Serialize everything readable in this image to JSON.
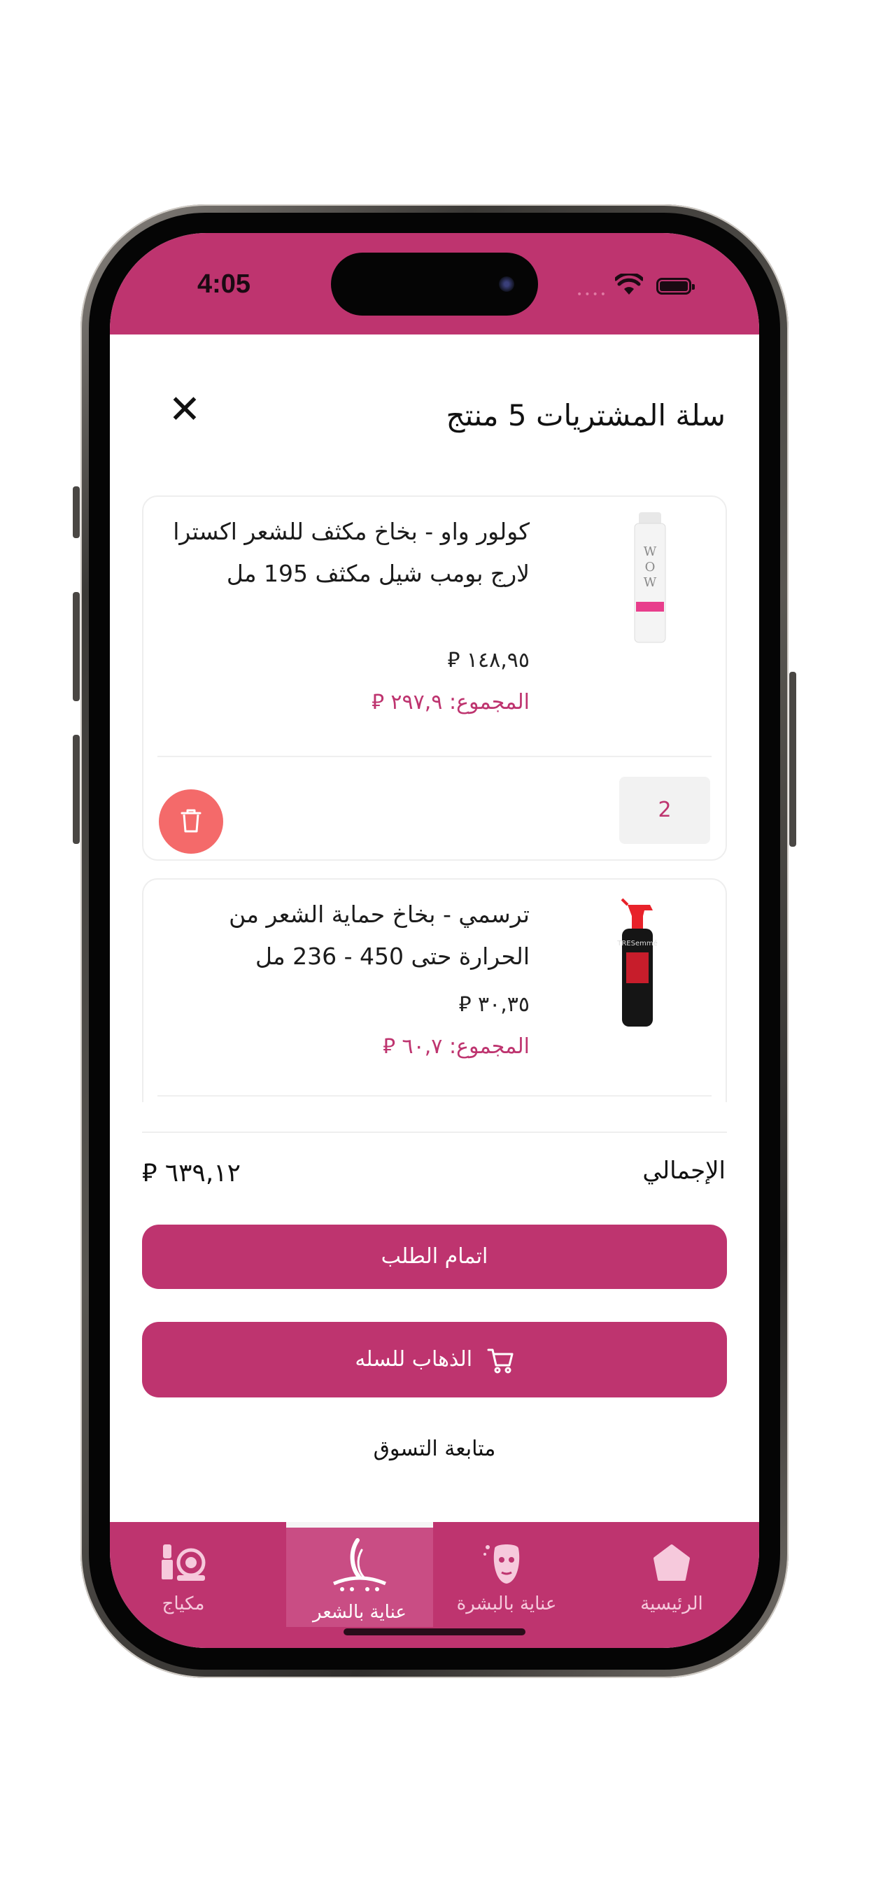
{
  "status_bar": {
    "time": "4:05"
  },
  "header": {
    "title": "سلة المشتريات 5 منتج",
    "close_icon": "close-icon"
  },
  "cart": {
    "items": [
      {
        "name": "كولور واو - بخاخ مكثف للشعر اكسترا لارج بومب شيل مكثف 195 مل",
        "price": "١٤٨,٩٥ ⃁",
        "total": "المجموع: ٢٩٧,٩ ⃁",
        "quantity": "2",
        "image": "color-wow-spray-bottle"
      },
      {
        "name": "ترسمي - بخاخ حماية الشعر من الحرارة حتى 450 - 236 مل",
        "price": "٣٠,٣٥ ⃁",
        "total": "المجموع: ٦٠,٧ ⃁",
        "image": "tresemme-spray-bottle"
      }
    ]
  },
  "summary": {
    "total_label": "الإجمالي",
    "total_value": "٦٣٩,١٢ ⃁"
  },
  "actions": {
    "checkout": "اتمام الطلب",
    "go_to_cart": "الذهاب للسله",
    "continue_shopping": "متابعة التسوق"
  },
  "tabbar": {
    "tabs": [
      {
        "label": "مكياج",
        "icon": "makeup-icon"
      },
      {
        "label": "عناية بالشعر",
        "icon": "hair-care-icon",
        "active": true
      },
      {
        "label": "عناية بالبشرة",
        "icon": "skin-care-icon"
      },
      {
        "label": "الرئيسية",
        "icon": "home-icon"
      }
    ]
  },
  "colors": {
    "brand": "#be346f",
    "delete": "#f46a6a",
    "tab_text": "#f6c9dc"
  }
}
